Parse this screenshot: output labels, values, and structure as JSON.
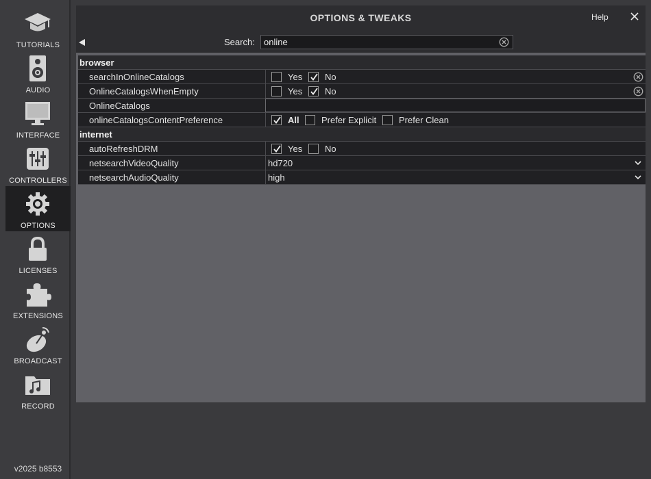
{
  "sidebar": {
    "items": [
      {
        "label": "TUTORIALS",
        "icon": "graduation-cap-icon"
      },
      {
        "label": "AUDIO",
        "icon": "speaker-icon"
      },
      {
        "label": "INTERFACE",
        "icon": "monitor-icon"
      },
      {
        "label": "CONTROLLERS",
        "icon": "sliders-icon"
      },
      {
        "label": "OPTIONS",
        "icon": "gear-icon",
        "active": true
      },
      {
        "label": "LICENSES",
        "icon": "lock-icon"
      },
      {
        "label": "EXTENSIONS",
        "icon": "puzzle-icon"
      },
      {
        "label": "BROADCAST",
        "icon": "satellite-dish-icon"
      },
      {
        "label": "RECORD",
        "icon": "music-folder-icon"
      }
    ],
    "version": "v2025 b8553"
  },
  "window": {
    "title": "OPTIONS & TWEAKS",
    "help": "Help"
  },
  "search": {
    "label": "Search:",
    "value": "online"
  },
  "sections": [
    {
      "name": "browser",
      "rows": [
        {
          "key": "searchInOnlineCatalogs",
          "options": [
            {
              "label": "Yes",
              "checked": false
            },
            {
              "label": "No",
              "checked": true
            }
          ],
          "clearable": true
        },
        {
          "key": "OnlineCatalogsWhenEmpty",
          "options": [
            {
              "label": "Yes",
              "checked": false
            },
            {
              "label": "No",
              "checked": true
            }
          ],
          "clearable": true
        },
        {
          "key": "OnlineCatalogs",
          "value": ""
        },
        {
          "key": "onlineCatalogsContentPreference",
          "options": [
            {
              "label": "All",
              "checked": true
            },
            {
              "label": "Prefer Explicit",
              "checked": false
            },
            {
              "label": "Prefer Clean",
              "checked": false
            }
          ]
        }
      ]
    },
    {
      "name": "internet",
      "rows": [
        {
          "key": "autoRefreshDRM",
          "options": [
            {
              "label": "Yes",
              "checked": true
            },
            {
              "label": "No",
              "checked": false
            }
          ]
        },
        {
          "key": "netsearchVideoQuality",
          "select": "hd720"
        },
        {
          "key": "netsearchAudioQuality",
          "select": "high"
        }
      ]
    }
  ]
}
